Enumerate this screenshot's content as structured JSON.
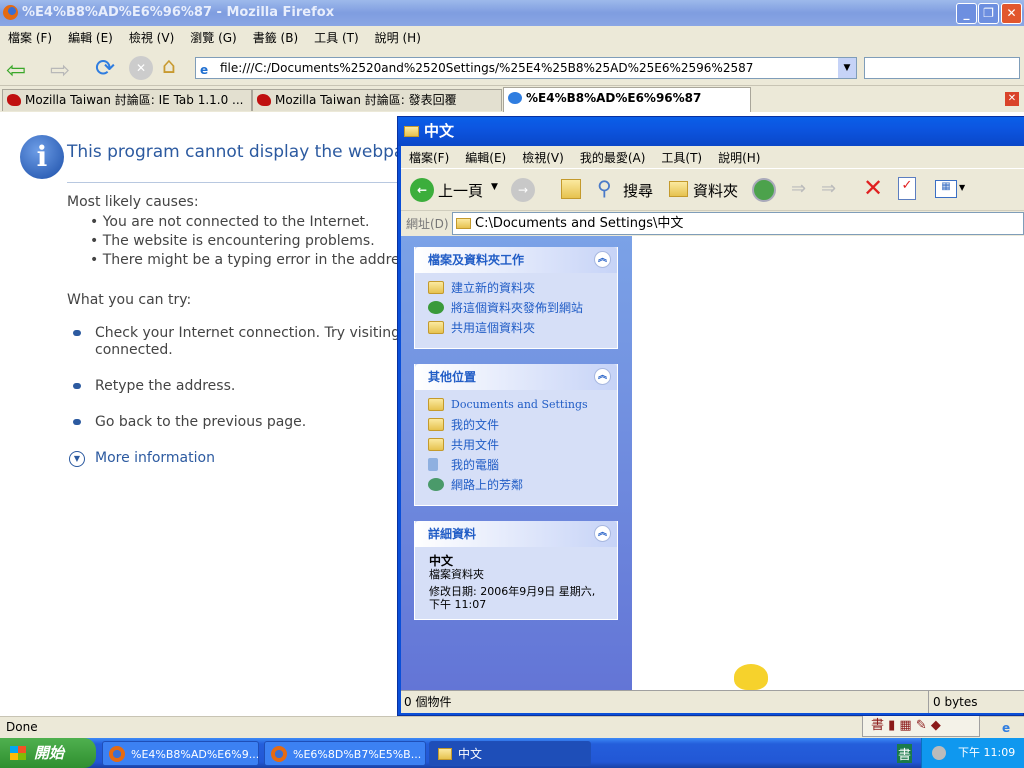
{
  "firefox": {
    "title": "%E4%B8%AD%E6%96%87 - Mozilla Firefox",
    "menu": [
      "檔案 (F)",
      "編輯 (E)",
      "檢視 (V)",
      "瀏覽 (G)",
      "書籤 (B)",
      "工具 (T)",
      "說明 (H)"
    ],
    "url": "file:///C:/Documents%2520and%2520Settings/%25E4%25B8%25AD%25E6%2596%2587",
    "tabs": [
      "Mozilla Taiwan 討論區: IE Tab 1.1.0 ...",
      "Mozilla Taiwan 討論區: 發表回覆",
      "%E4%B8%AD%E6%96%87"
    ],
    "status": "Done"
  },
  "error_page": {
    "heading": "This program cannot display the webpage",
    "causes_title": "Most likely causes:",
    "causes": [
      "You are not connected to the Internet.",
      "The website is encountering problems.",
      "There might be a typing error in the address."
    ],
    "try_title": "What you can try:",
    "tries": [
      "Check your Internet connection. Try visiting another website to make sure you are",
      "connected.",
      "Retype the address.",
      "Go back to the previous page."
    ],
    "more": "More information"
  },
  "explorer": {
    "title": "中文",
    "menu": [
      "檔案(F)",
      "編輯(E)",
      "檢視(V)",
      "我的最愛(A)",
      "工具(T)",
      "說明(H)"
    ],
    "toolbar": {
      "back": "上一頁",
      "search": "搜尋",
      "folders": "資料夾"
    },
    "address_label": "網址(D)",
    "address": "C:\\Documents and Settings\\中文",
    "panels": [
      {
        "title": "檔案及資料夾工作",
        "items": [
          "建立新的資料夾",
          "將這個資料夾發佈到網站",
          "共用這個資料夾"
        ]
      },
      {
        "title": "其他位置",
        "items": [
          "Documents and Settings",
          "我的文件",
          "共用文件",
          "我的電腦",
          "網路上的芳鄰"
        ]
      },
      {
        "title": "詳細資料",
        "name": "中文",
        "type": "檔案資料夾",
        "modified": "修改日期: 2006年9月9日 星期六,",
        "time": "下午 11:07"
      }
    ],
    "status_left": "0 個物件",
    "status_right": "0 bytes"
  },
  "taskbar": {
    "start": "開始",
    "buttons": [
      "%E4%B8%AD%E6%9...",
      "%E6%8D%B7%E5%B...",
      "中文"
    ],
    "ime": "書",
    "clock": "下午 11:09"
  }
}
